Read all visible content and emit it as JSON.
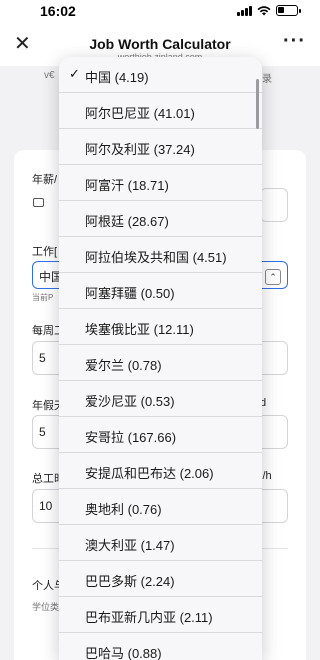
{
  "status": {
    "time": "16:02"
  },
  "browser": {
    "title": "Job Worth Calculator",
    "url": "worthjob.zipland.com",
    "close_icon": "close-icon",
    "more_icon": "more-icon"
  },
  "background": {
    "sub_left": "v€",
    "sub_right": "录",
    "salary_label": "年薪/",
    "country_label": "工作[",
    "country_value": "中国",
    "country_hint": "当前P",
    "weekly_label": "每周工",
    "weekly_value": "5",
    "vacation_label": "年假天",
    "vacation_value": "5",
    "vacation_right": "d",
    "total_label": "总工时",
    "total_value": "10",
    "total_right": "i/h",
    "personal_label": "个人与",
    "degree_label": "学位类"
  },
  "dropdown": {
    "selected_index": 0,
    "options": [
      {
        "label": "中国 (4.19)",
        "selected": true
      },
      {
        "label": "阿尔巴尼亚 (41.01)"
      },
      {
        "label": "阿尔及利亚 (37.24)"
      },
      {
        "label": "阿富汗 (18.71)"
      },
      {
        "label": "阿根廷 (28.67)"
      },
      {
        "label": "阿拉伯埃及共和国 (4.51)"
      },
      {
        "label": "阿塞拜疆 (0.50)"
      },
      {
        "label": "埃塞俄比亚 (12.11)"
      },
      {
        "label": "爱尔兰 (0.78)"
      },
      {
        "label": "爱沙尼亚 (0.53)"
      },
      {
        "label": "安哥拉 (167.66)"
      },
      {
        "label": "安提瓜和巴布达 (2.06)"
      },
      {
        "label": "奥地利 (0.76)"
      },
      {
        "label": "澳大利亚 (1.47)"
      },
      {
        "label": "巴巴多斯 (2.24)"
      },
      {
        "label": "巴布亚新几内亚 (2.11)"
      },
      {
        "label": "巴哈马 (0.88)"
      }
    ]
  },
  "colors": {
    "accent": "#2f6fe4",
    "card": "#ffffff",
    "page": "#f2f2f4",
    "dropdown": "#f7f7f9"
  }
}
